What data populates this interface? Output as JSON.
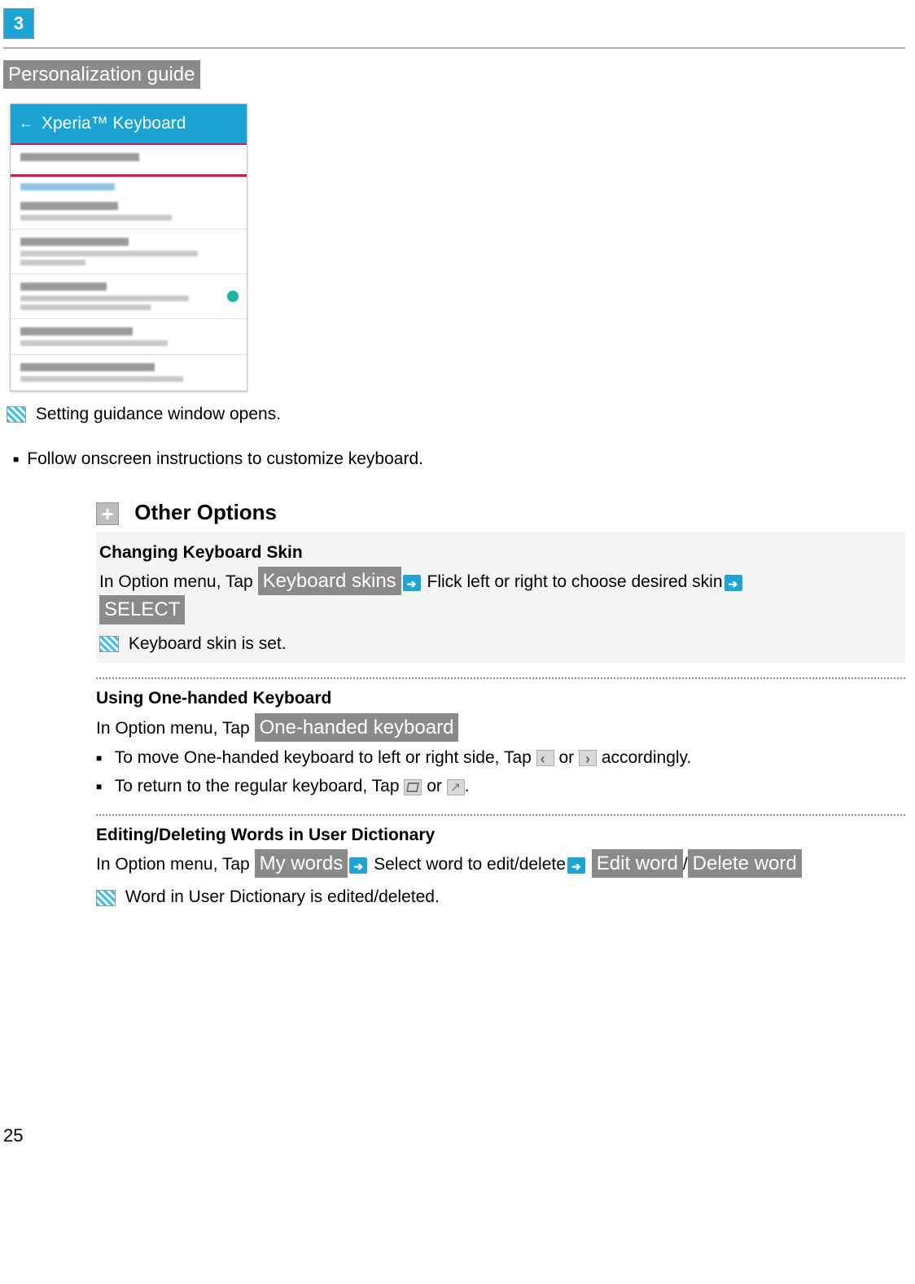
{
  "step": {
    "number": "3"
  },
  "chip_personalization": "Personalization guide",
  "phoneshot": {
    "header": "Xperia™ Keyboard"
  },
  "result1": "Setting guidance window opens.",
  "bullet_follow": "Follow onscreen instructions to customize keyboard.",
  "section_title": "Other Options",
  "skin": {
    "heading": "Changing Keyboard Skin",
    "pre1": "In Option menu, Tap ",
    "chip1": "Keyboard skins",
    "mid1": " Flick left or right to choose desired skin",
    "chip2": "SELECT",
    "result": "Keyboard skin is set."
  },
  "onehand": {
    "heading": "Using One-handed Keyboard",
    "pre1": "In Option menu, Tap ",
    "chip1": "One-handed keyboard",
    "b1a": "To move One-handed keyboard to left or right side, Tap ",
    "b1b": " or ",
    "b1c": " accordingly.",
    "b2a": "To return to the regular keyboard, Tap ",
    "b2b": " or ",
    "b2c": "."
  },
  "dict": {
    "heading": "Editing/Deleting Words in User Dictionary",
    "pre1": "In Option menu, Tap ",
    "chip1": "My words",
    "mid1": " Select word to edit/delete",
    "chip2": "Edit word",
    "sep": "/",
    "chip3": "Delete word",
    "result": "Word in User Dictionary is edited/deleted."
  },
  "page_number": "25"
}
